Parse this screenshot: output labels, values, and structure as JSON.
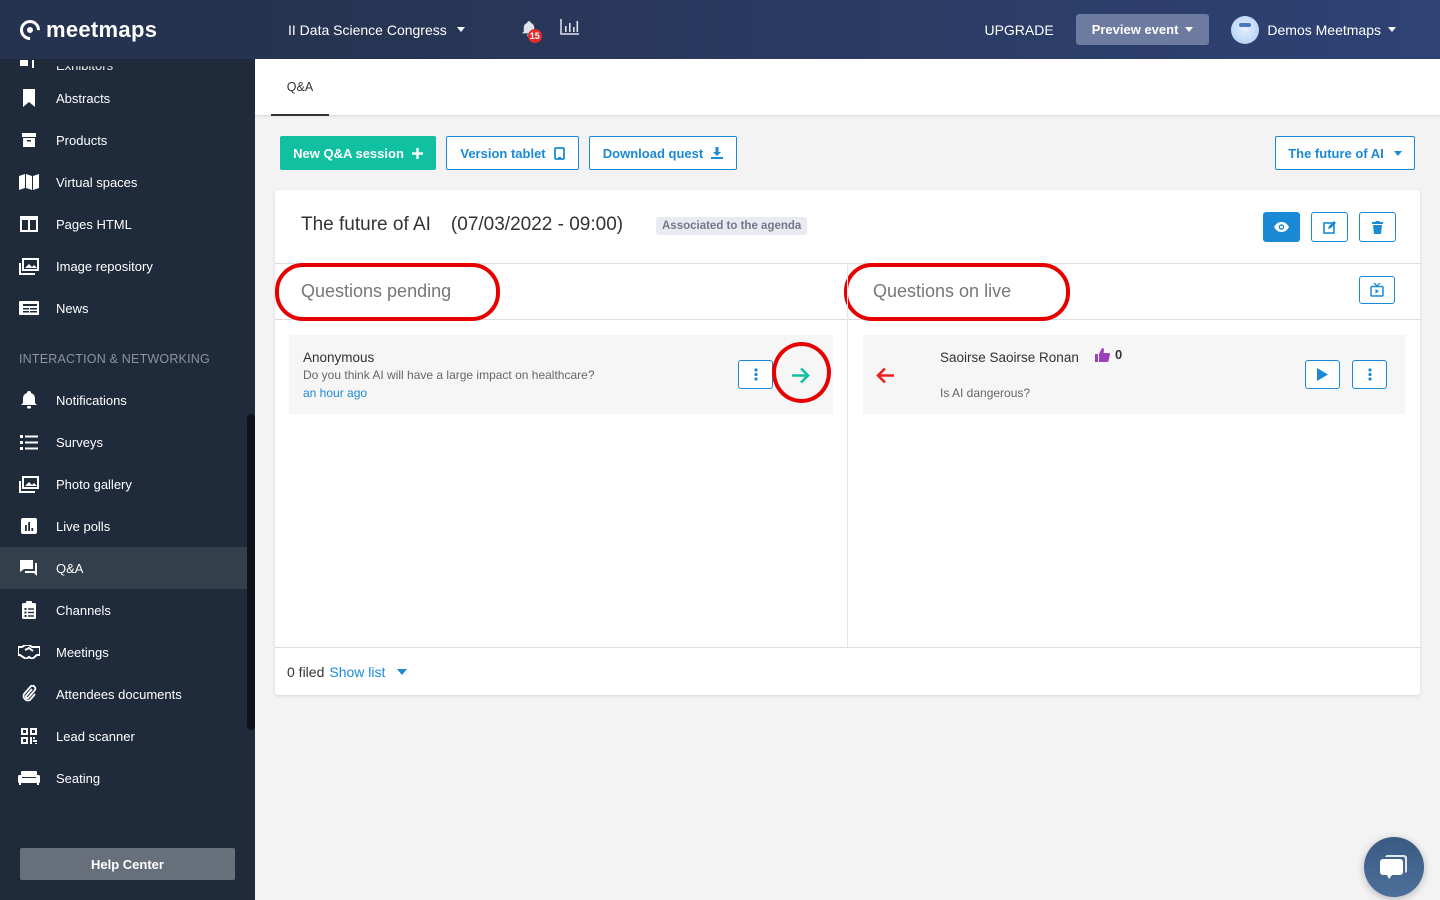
{
  "brand": {
    "name": "meetmaps"
  },
  "sidebar": {
    "partial_item": {
      "label": "Exhibitors",
      "icon": "store-icon"
    },
    "items": [
      {
        "label": "Abstracts",
        "icon": "bookmark-icon"
      },
      {
        "label": "Products",
        "icon": "archive-box-icon"
      },
      {
        "label": "Virtual spaces",
        "icon": "map-icon"
      },
      {
        "label": "Pages HTML",
        "icon": "columns-icon"
      },
      {
        "label": "Image repository",
        "icon": "images-icon"
      },
      {
        "label": "News",
        "icon": "newspaper-icon"
      }
    ],
    "section_label": "INTERACTION & NETWORKING",
    "section_items": [
      {
        "label": "Notifications",
        "icon": "bell-icon"
      },
      {
        "label": "Surveys",
        "icon": "list-icon"
      },
      {
        "label": "Photo gallery",
        "icon": "images-icon"
      },
      {
        "label": "Live polls",
        "icon": "poll-icon"
      },
      {
        "label": "Q&A",
        "icon": "comments-icon",
        "active": true
      },
      {
        "label": "Channels",
        "icon": "clipboard-list-icon"
      },
      {
        "label": "Meetings",
        "icon": "handshake-icon"
      },
      {
        "label": "Attendees documents",
        "icon": "paperclip-icon"
      },
      {
        "label": "Lead scanner",
        "icon": "qrcode-icon"
      },
      {
        "label": "Seating",
        "icon": "couch-icon"
      }
    ],
    "help_center_label": "Help Center"
  },
  "topbar": {
    "event_name": "II Data Science Congress",
    "notification_count": "15",
    "upgrade_label": "UPGRADE",
    "preview_label": "Preview event",
    "user_name": "Demos Meetmaps"
  },
  "tabs": [
    {
      "label": "Q&A",
      "active": true
    }
  ],
  "actions": {
    "new_session_label": "New Q&A session",
    "version_tablet_label": "Version tablet",
    "download_label": "Download quest",
    "session_select_value": "The future of AI"
  },
  "session": {
    "title": "The future of AI",
    "date": "(07/03/2022 - 09:00)",
    "badge": "Associated to the agenda"
  },
  "pending": {
    "title": "Questions pending",
    "questions": [
      {
        "author": "Anonymous",
        "text": "Do you think AI will have a large impact on healthcare?",
        "time": "an hour ago"
      }
    ]
  },
  "live": {
    "title": "Questions on live",
    "questions": [
      {
        "author": "Saoirse Saoirse Ronan",
        "likes": "0",
        "text": "Is AI dangerous?"
      }
    ]
  },
  "footer": {
    "filed_count": "0 filed",
    "show_list_label": "Show list"
  },
  "colors": {
    "accent": "#1a8ad6",
    "green": "#11c0a0",
    "highlight": "#e80000",
    "sidebar": "#1f2a3b"
  }
}
